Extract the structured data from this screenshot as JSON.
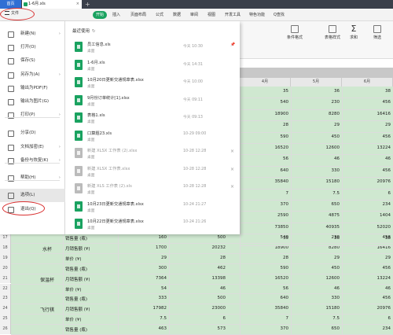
{
  "titlebar": {
    "home": "首页",
    "tab": "1-6月.xls",
    "close": "×",
    "plus": "+"
  },
  "menubar": {
    "file": "文件",
    "items": [
      "开始",
      "插入",
      "页面布局",
      "公式",
      "数据",
      "审阅",
      "视图",
      "开发工具",
      "特色功能"
    ],
    "active_index": 0,
    "search": "Q查找"
  },
  "toolbar": {
    "tools": [
      {
        "label": "条件格式",
        "icon": "conditional-format-icon"
      },
      {
        "label": "表格样式",
        "icon": "table-style-icon"
      },
      {
        "label": "求和",
        "icon": "sigma-icon"
      },
      {
        "label": "筛选",
        "icon": "filter-icon"
      }
    ],
    "sigma": "Σ"
  },
  "file_menu": {
    "items": [
      {
        "label": "新建(N)",
        "arrow": "›",
        "icon": "new-file-icon"
      },
      {
        "label": "打开(O)",
        "arrow": "",
        "icon": "open-folder-icon"
      },
      {
        "label": "保存(S)",
        "arrow": "",
        "icon": "save-icon"
      },
      {
        "label": "另存为(A)",
        "arrow": "›",
        "icon": "save-as-icon"
      },
      {
        "label": "输出为PDF(F)",
        "arrow": "",
        "icon": "pdf-icon"
      },
      {
        "label": "输出为图片(G)",
        "arrow": "",
        "icon": "image-export-icon"
      },
      {
        "label": "打印(P)",
        "arrow": "›",
        "icon": "print-icon"
      },
      {
        "label": "分享(D)",
        "arrow": "",
        "icon": "share-icon"
      },
      {
        "label": "文档加密(E)",
        "arrow": "›",
        "icon": "lock-icon"
      },
      {
        "label": "备份与恢复(K)",
        "arrow": "›",
        "icon": "backup-icon"
      },
      {
        "label": "帮助(H)",
        "arrow": "›",
        "icon": "help-icon"
      },
      {
        "label": "选项(L)",
        "arrow": "",
        "icon": "gear-icon"
      },
      {
        "label": "退出(Q)",
        "arrow": "",
        "icon": "exit-icon"
      }
    ]
  },
  "recent": {
    "title": "最近使用",
    "refresh": "↻",
    "files": [
      {
        "name": "员工信息.xls",
        "loc": "桌面",
        "time": "今天 10:30",
        "gray": false,
        "action": "📌"
      },
      {
        "name": "1-6月.xls",
        "loc": "桌面",
        "time": "今天 14:31",
        "gray": false,
        "action": ""
      },
      {
        "name": "10月20日更新交通规章表.xlsx",
        "loc": "桌面",
        "time": "今天 10:00",
        "gray": false,
        "action": ""
      },
      {
        "name": "9月份订单统计[1].xlsx",
        "loc": "桌面",
        "time": "今天 09:11",
        "gray": false,
        "action": ""
      },
      {
        "name": "表格1.xls",
        "loc": "桌面",
        "time": "今天 09:13",
        "gray": false,
        "action": ""
      },
      {
        "name": "口算题23.xls",
        "loc": "桌面",
        "time": "10-29 09:00",
        "gray": false,
        "action": ""
      },
      {
        "name": "新建 XLSX 工作表 (2).xlsx",
        "loc": "桌面",
        "time": "10-28 12:28",
        "gray": true,
        "action": "×"
      },
      {
        "name": "新建 XLSX 工作表.xlsx",
        "loc": "桌面",
        "time": "10-28 12:28",
        "gray": true,
        "action": "×"
      },
      {
        "name": "新建 XLS 工作表 (2).xls",
        "loc": "桌面",
        "time": "10-28 12:28",
        "gray": true,
        "action": "×"
      },
      {
        "name": "10月23日更新交通规章表.xlsx",
        "loc": "桌面",
        "time": "10-24 21:27",
        "gray": false,
        "action": ""
      },
      {
        "name": "10月22日更新交通规章表.xlsx",
        "loc": "桌面",
        "time": "10-24 21:26",
        "gray": false,
        "action": ""
      }
    ]
  },
  "sheet": {
    "col_headers": [
      "4月",
      "5月",
      "6月"
    ],
    "right_values": [
      [
        "35",
        "36",
        "38"
      ],
      [
        "540",
        "230",
        "456"
      ],
      [
        "18900",
        "8280",
        "16416"
      ],
      [
        "28",
        "29",
        "29"
      ],
      [
        "590",
        "450",
        "456"
      ],
      [
        "16520",
        "12600",
        "13224"
      ],
      [
        "56",
        "46",
        "46"
      ],
      [
        "640",
        "330",
        "456"
      ],
      [
        "35840",
        "15180",
        "20976"
      ],
      [
        "7",
        "7.5",
        "6"
      ],
      [
        "370",
        "650",
        "234"
      ],
      [
        "2590",
        "4875",
        "1404"
      ],
      [
        "73850",
        "40935",
        "52020"
      ],
      [
        "35",
        "36",
        "38"
      ],
      [
        "",
        "",
        ""
      ],
      [
        "",
        "",
        ""
      ]
    ],
    "row_numbers": [
      "17",
      "18",
      "19",
      "20",
      "21",
      "22",
      "23",
      "24",
      "25",
      "26"
    ],
    "bottom_rows": [
      {
        "group": "",
        "label": "销售量 (瓶)",
        "c": "160",
        "d": "500",
        "e": "540",
        "f": "230",
        "g": "456"
      },
      {
        "group": "水杯",
        "label": "月销售额 (¥)",
        "c": "1700",
        "d": "20232",
        "e": "18900",
        "f": "8280",
        "g": "16416"
      },
      {
        "group": "",
        "label": "单价 (¥)",
        "c": "29",
        "d": "28",
        "e": "28",
        "f": "29",
        "g": "29"
      },
      {
        "group": "",
        "label": "销售量 (瓶)",
        "c": "300",
        "d": "462",
        "e": "590",
        "f": "450",
        "g": "456"
      },
      {
        "group": "保温杯",
        "label": "月销售额 (¥)",
        "c": "7364",
        "d": "13398",
        "e": "16520",
        "f": "12600",
        "g": "13224"
      },
      {
        "group": "",
        "label": "单价 (¥)",
        "c": "54",
        "d": "46",
        "e": "56",
        "f": "46",
        "g": "46"
      },
      {
        "group": "",
        "label": "销售量 (瓶)",
        "c": "333",
        "d": "500",
        "e": "640",
        "f": "330",
        "g": "456"
      },
      {
        "group": "飞行棋",
        "label": "月销售额 (¥)",
        "c": "17982",
        "d": "23000",
        "e": "35840",
        "f": "15180",
        "g": "20976"
      },
      {
        "group": "",
        "label": "单价 (¥)",
        "c": "7.5",
        "d": "6",
        "e": "7",
        "f": "7.5",
        "g": "6"
      },
      {
        "group": "",
        "label": "销售量 (瓶)",
        "c": "463",
        "d": "573",
        "e": "370",
        "f": "650",
        "g": "234"
      }
    ]
  },
  "colors": {
    "accent": "#1aa260",
    "highlight_ring": "#d93030",
    "sheet_green": "#cfe8d0"
  }
}
